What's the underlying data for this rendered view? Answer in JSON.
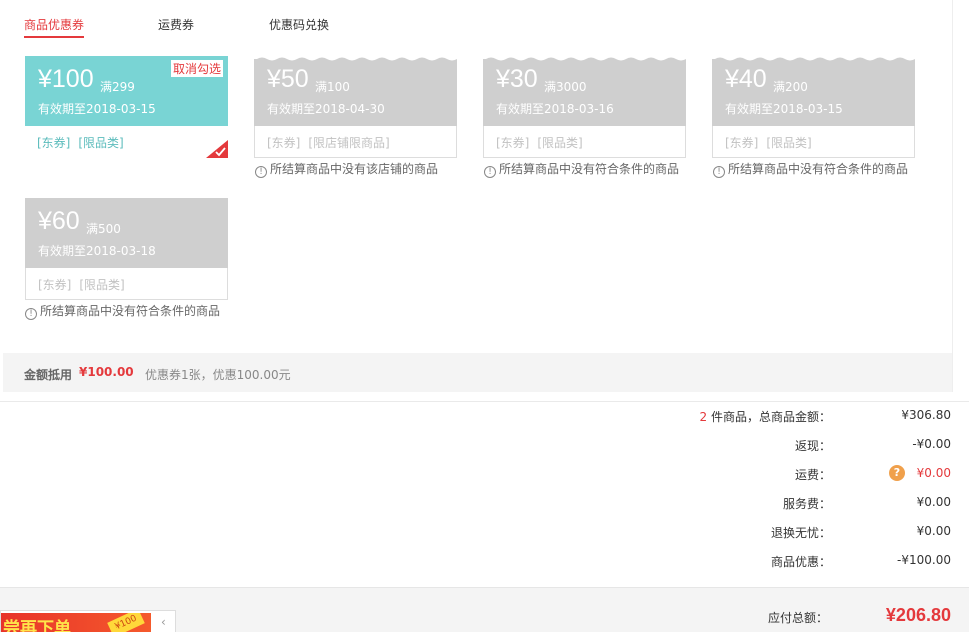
{
  "tabs": [
    {
      "label": "商品优惠券",
      "active": true
    },
    {
      "label": "运费券",
      "active": false
    },
    {
      "label": "优惠码兑换",
      "active": false
    }
  ],
  "coupons": [
    {
      "amount": "¥100",
      "condition": "满299",
      "valid": "有效期至2018-03-15",
      "tags": [
        "[东券]",
        "[限品类]"
      ],
      "selected": true,
      "cancel_label": "取消勾选",
      "reason": ""
    },
    {
      "amount": "¥50",
      "condition": "满100",
      "valid": "有效期至2018-04-30",
      "tags": [
        "[东券]",
        "[限店铺限商品]"
      ],
      "selected": false,
      "reason": "所结算商品中没有该店铺的商品"
    },
    {
      "amount": "¥30",
      "condition": "满3000",
      "valid": "有效期至2018-03-16",
      "tags": [
        "[东券]",
        "[限品类]"
      ],
      "selected": false,
      "reason": "所结算商品中没有符合条件的商品"
    },
    {
      "amount": "¥40",
      "condition": "满200",
      "valid": "有效期至2018-03-15",
      "tags": [
        "[东券]",
        "[限品类]"
      ],
      "selected": false,
      "reason": "所结算商品中没有符合条件的商品"
    },
    {
      "amount": "¥60",
      "condition": "满500",
      "valid": "有效期至2018-03-18",
      "tags": [
        "[东券]",
        "[限品类]"
      ],
      "selected": false,
      "reason": "所结算商品中没有符合条件的商品"
    }
  ],
  "discount_summary": {
    "label": "金额抵用",
    "amount": "¥100.00",
    "description": "优惠券1张，优惠100.00元"
  },
  "totals": {
    "item_count": "2",
    "rows": [
      {
        "label": "件商品，总商品金额：",
        "value": "¥306.80"
      },
      {
        "label": "返现：",
        "value": "-¥0.00"
      },
      {
        "label": "运费：",
        "value": "¥0.00"
      },
      {
        "label": "服务费：",
        "value": "¥0.00"
      },
      {
        "label": "退换无忧：",
        "value": "¥0.00"
      },
      {
        "label": "商品优惠：",
        "value": "-¥100.00"
      }
    ]
  },
  "payable": {
    "label": "应付总额：",
    "value": "¥206.80"
  },
  "banner": {
    "text": "尝再下单",
    "tag": "¥100"
  },
  "colors": {
    "accent": "#e4393c",
    "selected_coupon": "#79d4d4",
    "disabled_coupon": "#cfcfcf",
    "help_icon": "#f0a04b"
  }
}
